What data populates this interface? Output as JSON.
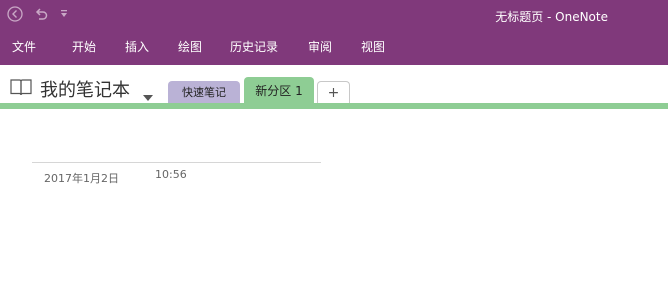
{
  "window": {
    "title": "无标题页 - OneNote"
  },
  "quick_access": {
    "back_icon": "back-arrow-icon",
    "undo_icon": "undo-icon",
    "customize_icon": "qat-customize-icon"
  },
  "menu": [
    {
      "label": "文件"
    },
    {
      "label": "开始"
    },
    {
      "label": "插入"
    },
    {
      "label": "绘图"
    },
    {
      "label": "历史记录"
    },
    {
      "label": "审阅"
    },
    {
      "label": "视图"
    }
  ],
  "notebook": {
    "name": "我的笔记本",
    "icon": "notebook-icon"
  },
  "sections": [
    {
      "label": "快速笔记",
      "color": "#bab2d6"
    },
    {
      "label": "新分区 1",
      "color": "#8ecd94",
      "active": true
    }
  ],
  "add_section": {
    "label": "+"
  },
  "page": {
    "date": "2017年1月2日",
    "time": "10:56"
  },
  "colors": {
    "ribbon": "#80397b",
    "section_accent": "#8ecd94"
  }
}
